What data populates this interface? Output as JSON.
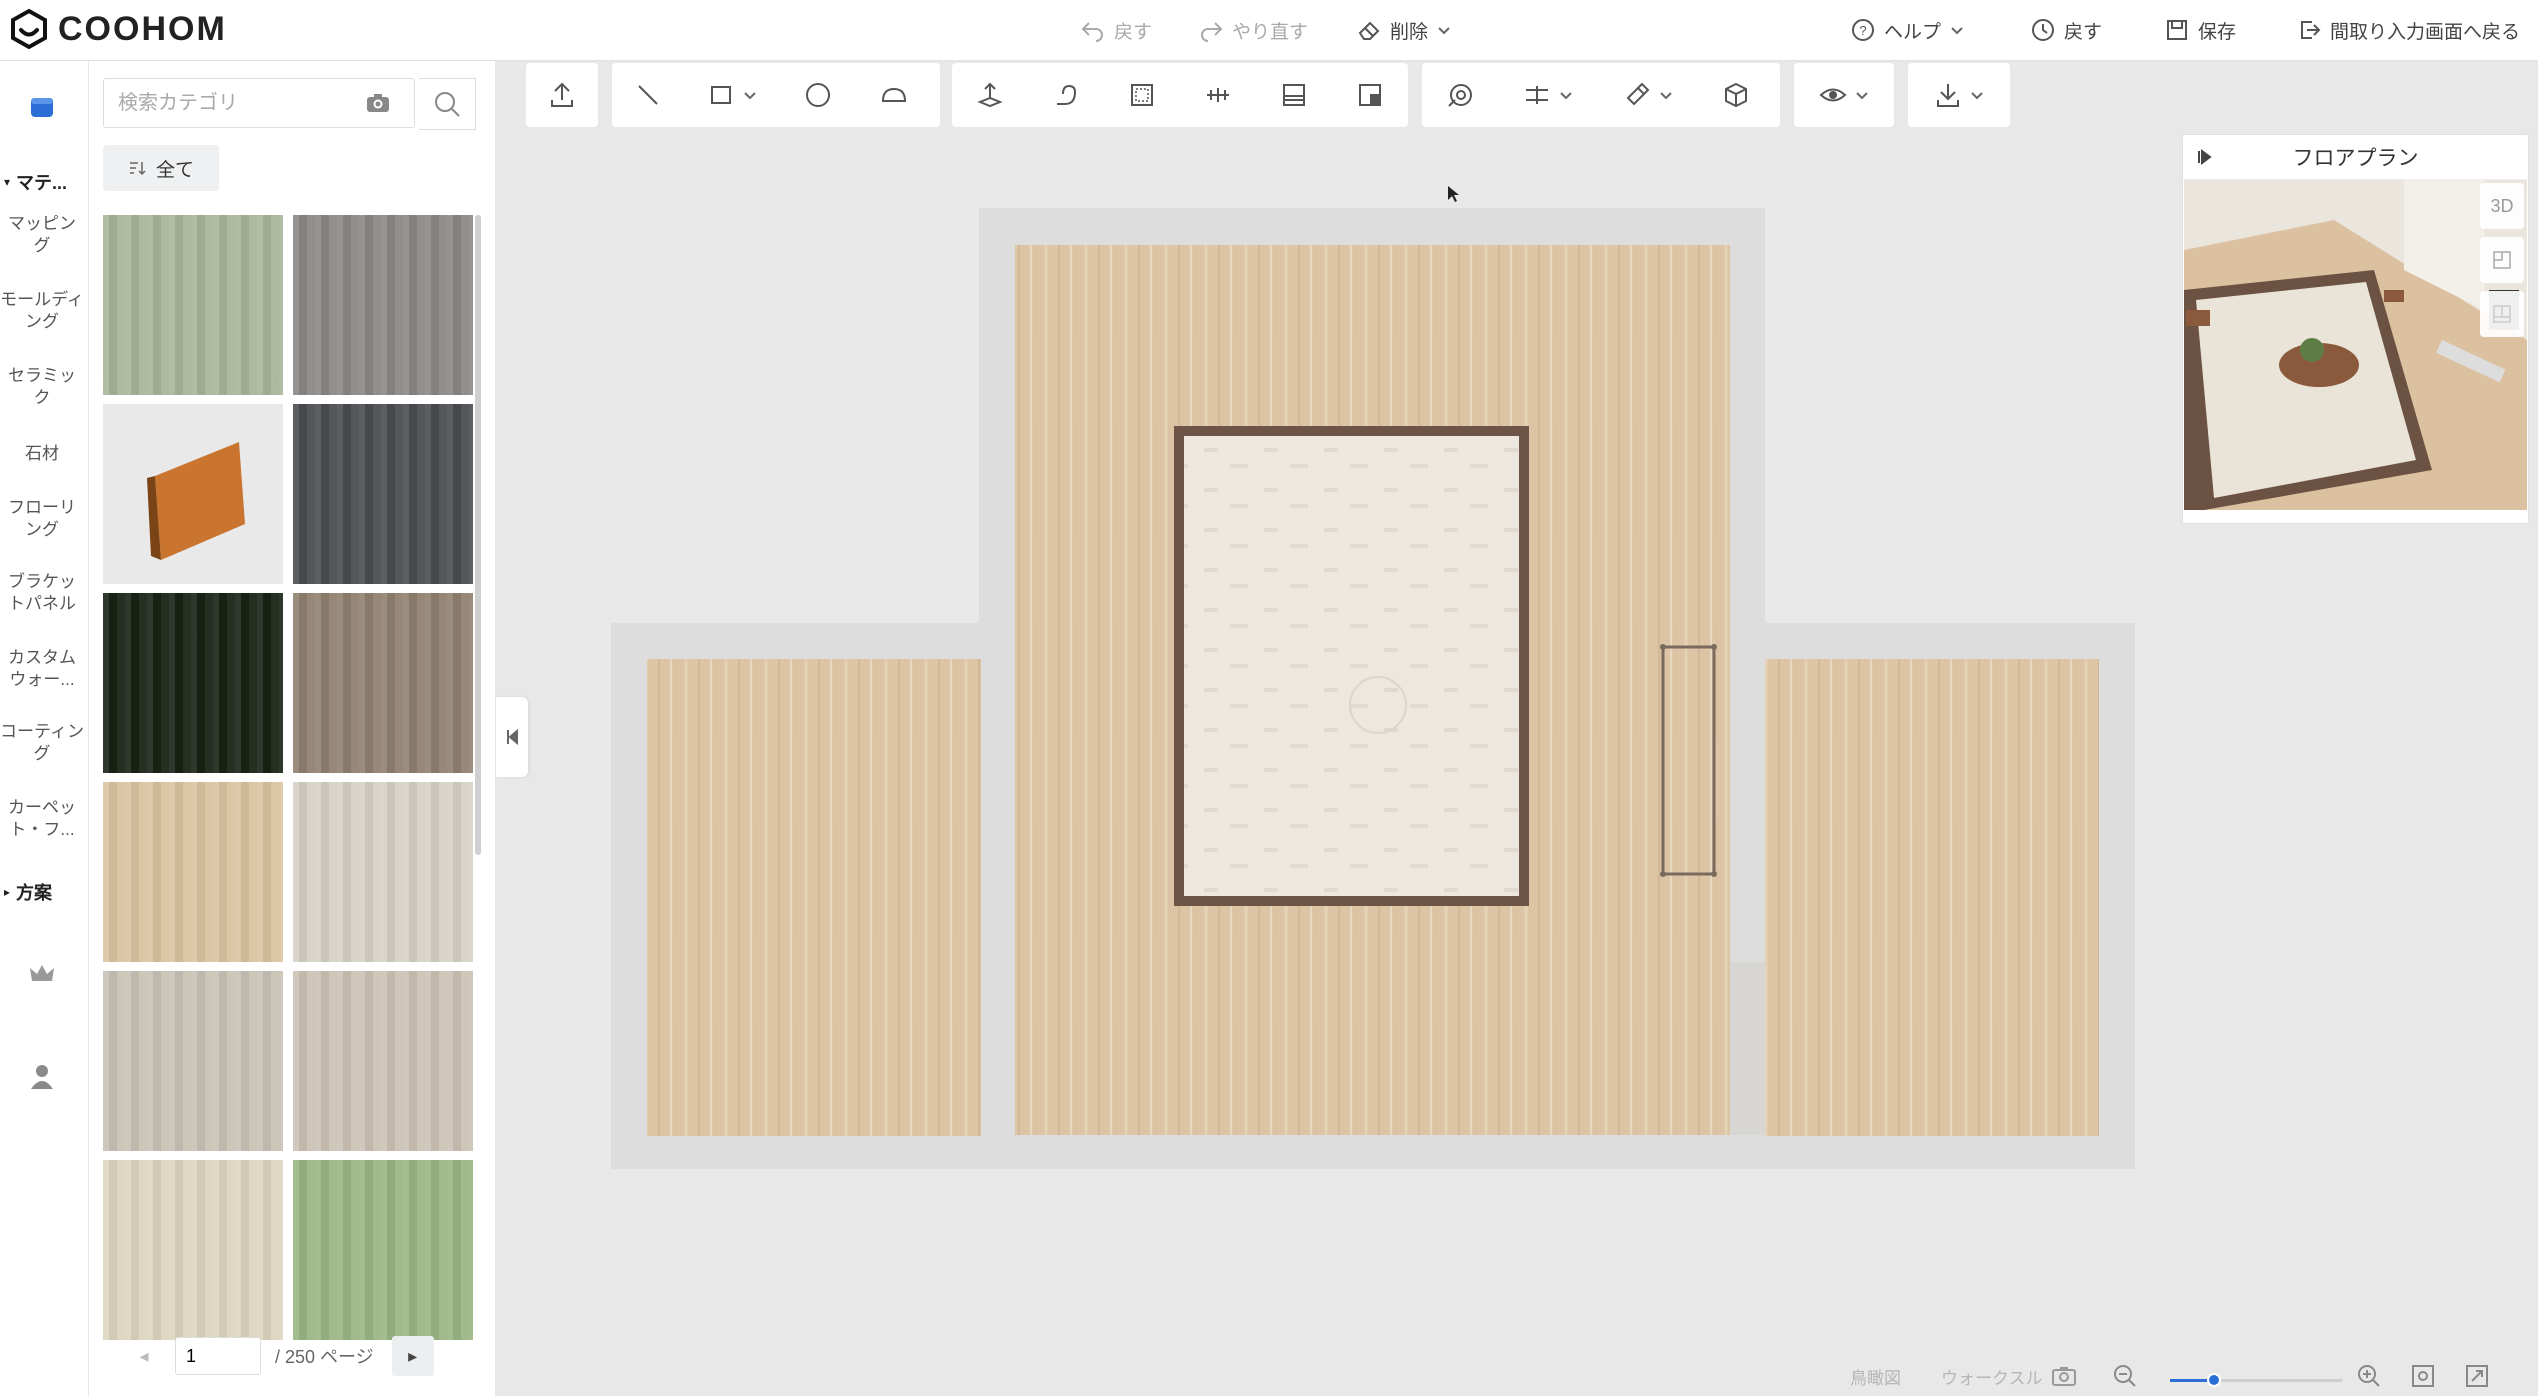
{
  "app": {
    "brand": "COOHOM",
    "accent": "#2b6fd6"
  },
  "topbar": {
    "undo": "戻す",
    "redo": "やり直す",
    "delete": "削除",
    "help": "ヘルプ",
    "history": "戻す",
    "save": "保存",
    "back_to_floorplan": "間取り入力画面へ戻る"
  },
  "rail": {
    "material_group": "マテ...",
    "items": [
      "マッピング",
      "モールディング",
      "セラミック",
      "石材",
      "フローリング",
      "ブラケットパネル",
      "カスタムウォー...",
      "コーティング",
      "カーペット・フ..."
    ],
    "plan_group": "方案"
  },
  "panel": {
    "search_placeholder": "検索カテゴリ",
    "all_filter": "全て",
    "swatches": [
      {
        "name": "birch-wood",
        "color": "#a9b59a"
      },
      {
        "name": "gray-fabric",
        "color": "#8a8886"
      },
      {
        "name": "wood-skirting",
        "color": "#c9742f"
      },
      {
        "name": "dark-stone",
        "color": "#4a4c4f"
      },
      {
        "name": "black-green",
        "color": "#172214"
      },
      {
        "name": "brown-wood",
        "color": "#8f8070"
      },
      {
        "name": "beige-marble",
        "color": "#d9c4a1"
      },
      {
        "name": "cream-marble",
        "color": "#d6d1c6"
      },
      {
        "name": "pale-wood",
        "color": "#c9c2b5"
      },
      {
        "name": "light-oak",
        "color": "#cbc2b4"
      },
      {
        "name": "plaid-fabric",
        "color": "#ddd5be"
      },
      {
        "name": "green-felt",
        "color": "#9ab684"
      }
    ],
    "page_current": "1",
    "page_total": "/ 250 ページ"
  },
  "preview": {
    "title": "フロアプラン",
    "btn_3d": "3D"
  },
  "bottom": {
    "bird_view": "鳥瞰図",
    "walk_view": "ウォークスル"
  }
}
